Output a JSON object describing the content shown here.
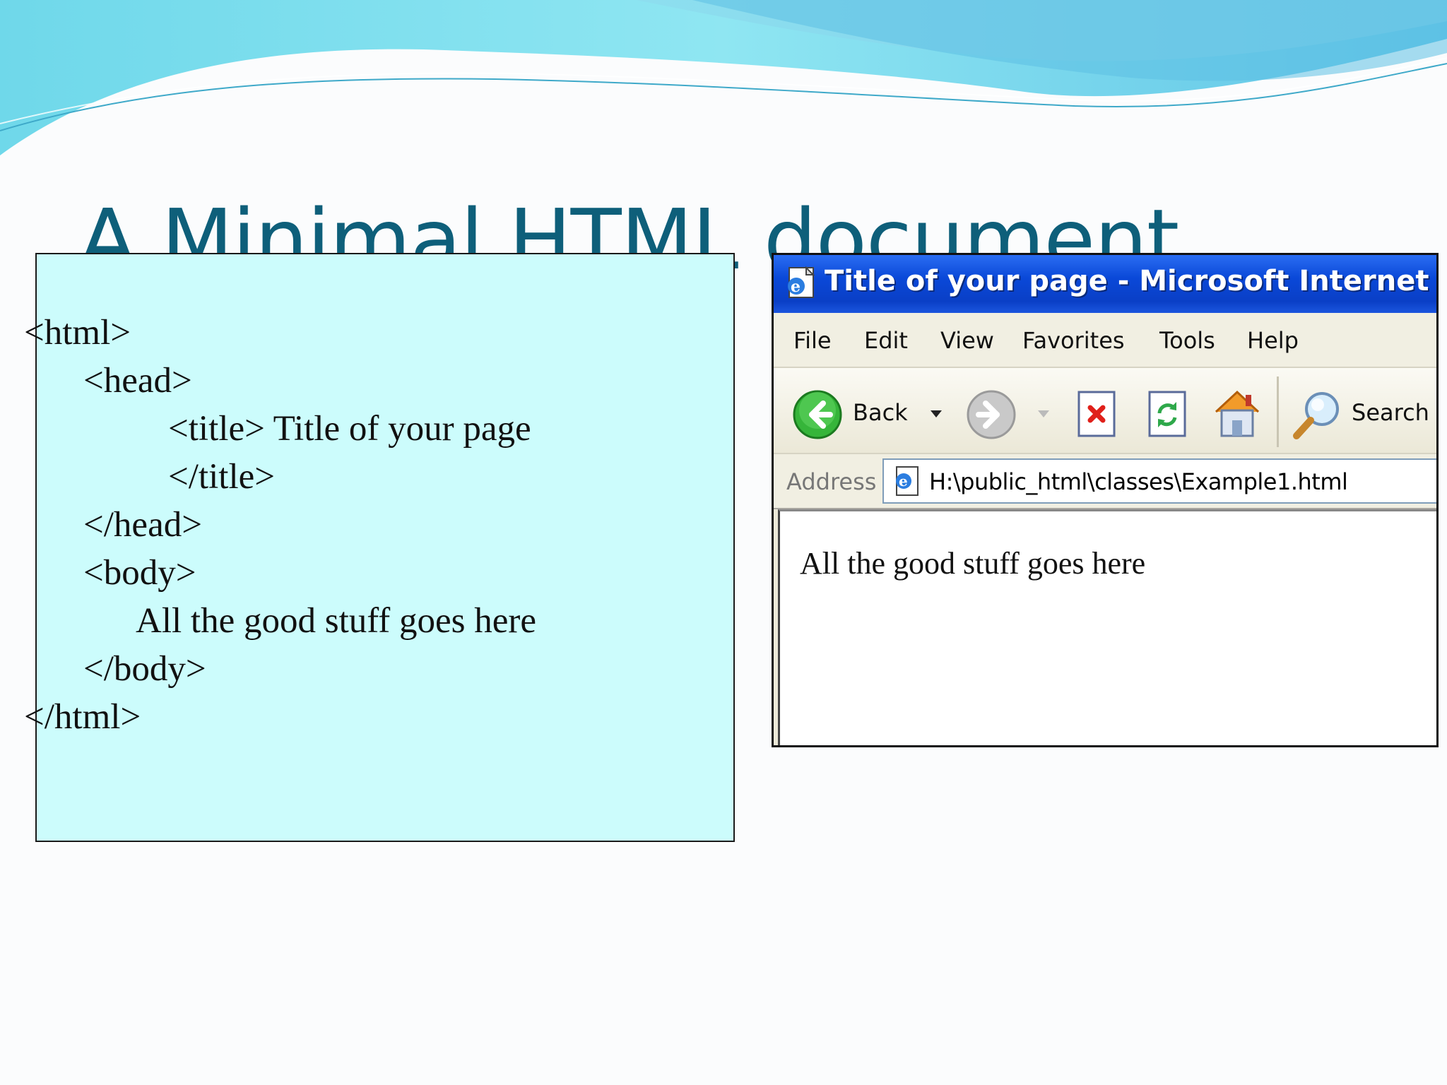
{
  "slide": {
    "title": "A Minimal HTML document"
  },
  "code": {
    "lines": [
      "<html>",
      "<head>",
      "<title> Title of your page",
      "</title>",
      "</head>",
      "<body>",
      "All the good stuff goes here",
      "</body>",
      "</html>"
    ]
  },
  "browser": {
    "title": "Title of your page - Microsoft Internet Explorer",
    "menu": [
      "File",
      "Edit",
      "View",
      "Favorites",
      "Tools",
      "Help"
    ],
    "toolbar": {
      "back_label": "Back",
      "search_label": "Search"
    },
    "address": {
      "label": "Address",
      "url": "H:\\public_html\\classes\\Example1.html"
    },
    "content_text": "All the good stuff goes here"
  },
  "colors": {
    "title": "#0e5f7a",
    "code_bg": "#ccfcfc",
    "ie_titlebar": "#0a48d8",
    "wave": "#7fd6ec"
  },
  "icons": [
    "ie-page-icon",
    "back-arrow-icon",
    "dropdown-arrow-icon",
    "forward-arrow-icon",
    "stop-icon",
    "refresh-icon",
    "home-icon",
    "search-magnifier-icon",
    "address-page-icon"
  ]
}
